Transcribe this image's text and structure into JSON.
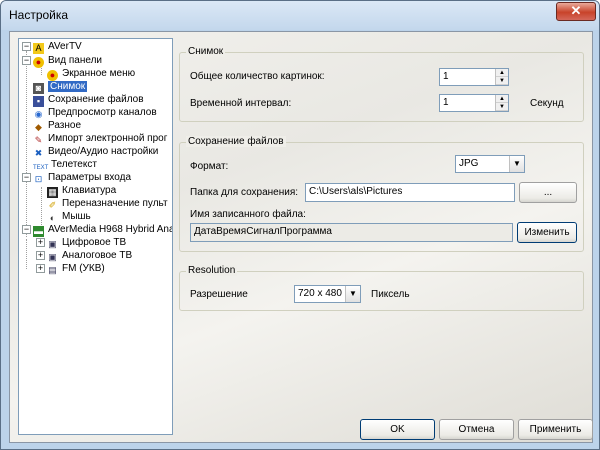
{
  "window": {
    "title": "Настройка",
    "close_glyph": "✕"
  },
  "tree": {
    "items": [
      {
        "label": "AVerTV",
        "icon": "avertv-logo-icon"
      },
      {
        "label": "Вид панели",
        "icon": "panel-view-icon"
      },
      {
        "label": "Экранное меню",
        "icon": "osd-menu-icon"
      },
      {
        "label": "Снимок",
        "icon": "snapshot-camera-icon"
      },
      {
        "label": "Сохранение файлов",
        "icon": "save-disk-icon"
      },
      {
        "label": "Предпросмотр каналов",
        "icon": "eye-icon"
      },
      {
        "label": "Разное",
        "icon": "misc-icon"
      },
      {
        "label": "Импорт электронной прог",
        "icon": "import-icon"
      },
      {
        "label": "Видео/Аудио настройки",
        "icon": "av-settings-icon"
      },
      {
        "label": "Телетекст",
        "icon": "teletext-icon"
      },
      {
        "label": "Параметры входа",
        "icon": "input-params-icon"
      },
      {
        "label": "Клавиатура",
        "icon": "keyboard-icon"
      },
      {
        "label": "Переназначение пульт",
        "icon": "remote-icon"
      },
      {
        "label": "Мышь",
        "icon": "mouse-icon"
      },
      {
        "label": "AVerMedia H968 Hybrid Ana",
        "icon": "device-card-icon"
      },
      {
        "label": "Цифровое ТВ",
        "icon": "tv-icon"
      },
      {
        "label": "Аналоговое ТВ",
        "icon": "tv-icon"
      },
      {
        "label": "FM (УКВ)",
        "icon": "radio-icon"
      }
    ],
    "teletext_icon_text": "TEXT",
    "expand_glyph": "−",
    "plus_glyph": "+"
  },
  "snapshot": {
    "title": "Снимок",
    "count_label": "Общее количество картинок:",
    "count_value": "1",
    "interval_label": "Временной интервал:",
    "interval_value": "1",
    "interval_unit": "Секунд"
  },
  "save": {
    "title": "Сохранение файлов",
    "format_label": "Формат:",
    "format_value": "JPG",
    "folder_label": "Папка для сохранения:",
    "folder_value": "C:\\Users\\als\\Pictures",
    "browse_label": "...",
    "filename_label": "Имя записанного файла:",
    "filename_value": "ДатаВремяСигналПрограмма",
    "change_label": "Изменить"
  },
  "resolution": {
    "title": "Resolution",
    "label": "Разрешение",
    "value": "720 x 480",
    "unit": "Пиксель"
  },
  "footer": {
    "ok": "OK",
    "cancel": "Отмена",
    "apply": "Применить"
  },
  "colors": {
    "selection": "#316ac5",
    "frame": "#bcd3ea",
    "close": "#c8432a"
  }
}
